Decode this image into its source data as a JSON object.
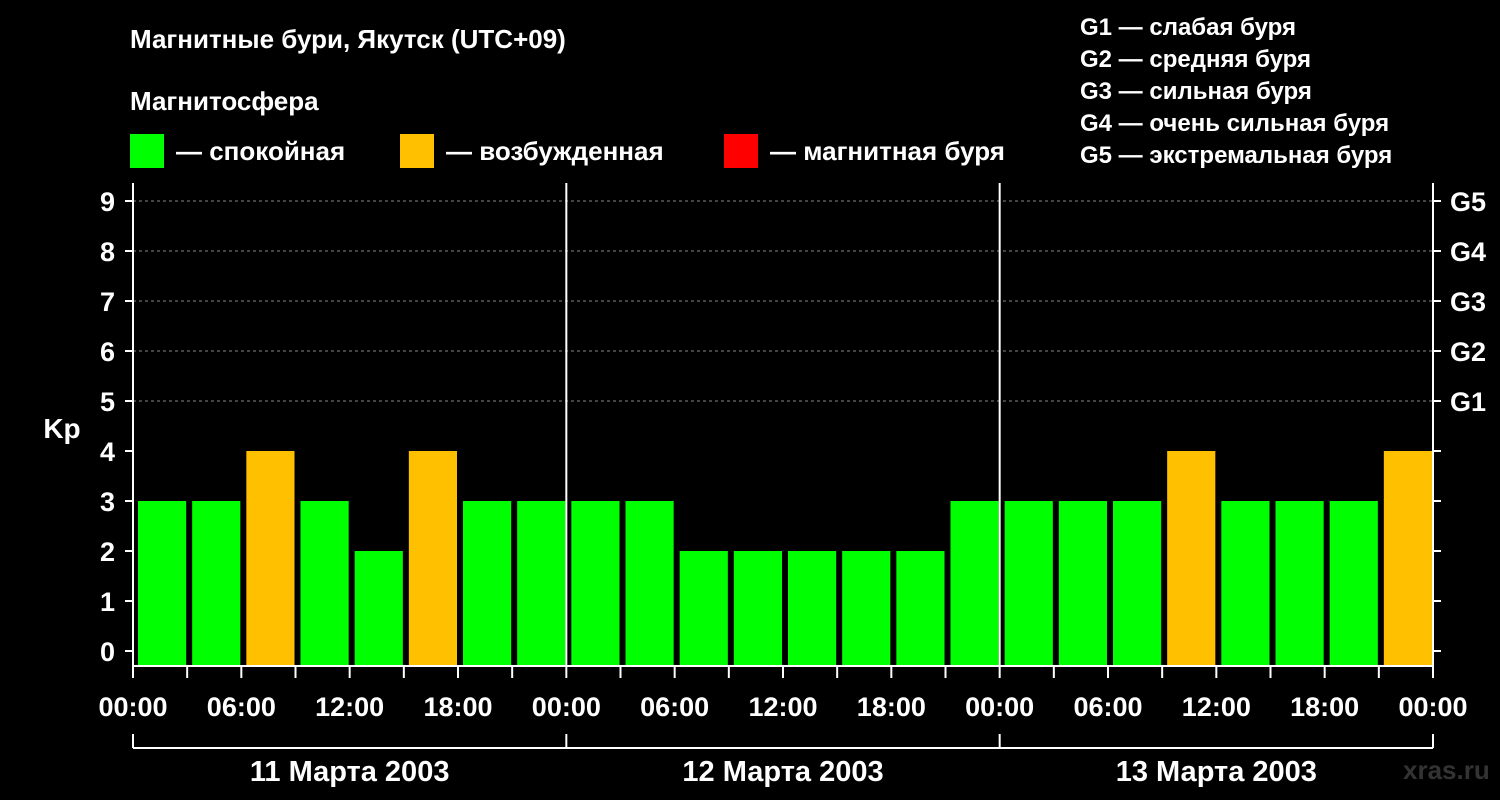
{
  "title": "Магнитные бури, Якутск (UTC+09)",
  "legend": {
    "heading": "Магнитосфера",
    "items": [
      {
        "label": "— спокойная",
        "color": "#00ff00"
      },
      {
        "label": "— возбужденная",
        "color": "#ffc000"
      },
      {
        "label": "— магнитная буря",
        "color": "#ff0000"
      }
    ]
  },
  "storm_levels": [
    "G1 — слабая буря",
    "G2 — средняя буря",
    "G3 — сильная буря",
    "G4 — очень сильная буря",
    "G5 — экстремальная буря"
  ],
  "watermark": "xras.ru",
  "chart_data": {
    "type": "bar",
    "ylabel": "Kp",
    "ylim": [
      0,
      9
    ],
    "yticks": [
      0,
      1,
      2,
      3,
      4,
      5,
      6,
      7,
      8,
      9
    ],
    "right_ticks": [
      {
        "value": 5,
        "label": "G1"
      },
      {
        "value": 6,
        "label": "G2"
      },
      {
        "value": 7,
        "label": "G3"
      },
      {
        "value": 8,
        "label": "G4"
      },
      {
        "value": 9,
        "label": "G5"
      }
    ],
    "grid": "dashed horizontal at Kp 5–9",
    "xtick_labels": [
      "00:00",
      "06:00",
      "12:00",
      "18:00",
      "00:00",
      "06:00",
      "12:00",
      "18:00",
      "00:00",
      "06:00",
      "12:00",
      "18:00",
      "00:00"
    ],
    "days": [
      "11 Марта 2003",
      "12 Марта 2003",
      "13 Марта 2003"
    ],
    "bar_interval_hours": 3,
    "values": [
      3,
      3,
      4,
      3,
      2,
      4,
      3,
      3,
      3,
      3,
      2,
      2,
      2,
      2,
      2,
      3,
      3,
      3,
      3,
      4,
      3,
      3,
      3,
      4
    ],
    "colors": {
      "quiet": "#00ff00",
      "active": "#ffc000",
      "storm": "#ff0000"
    }
  }
}
